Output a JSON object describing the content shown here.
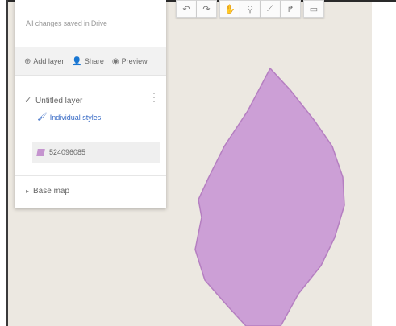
{
  "save_status": "All changes saved in Drive",
  "actions": {
    "add_layer": "Add layer",
    "share": "Share",
    "preview": "Preview"
  },
  "layer": {
    "name": "Untitled layer",
    "style_link": "Individual styles",
    "feature": {
      "label": "524096085",
      "color": "#c594cf"
    }
  },
  "base_map_label": "Base map",
  "toolbar": {
    "undo_symbol": "↶",
    "redo_symbol": "↷",
    "hand_symbol": "✋",
    "marker_symbol": "⚲",
    "line_symbol": "⟋",
    "route_symbol": "↱",
    "measure_symbol": "▭"
  },
  "colors": {
    "polygon_fill": "#cc9fd6",
    "polygon_stroke": "#b57fc1",
    "map_background": "#ece8e1",
    "link_blue": "#3367c4"
  }
}
